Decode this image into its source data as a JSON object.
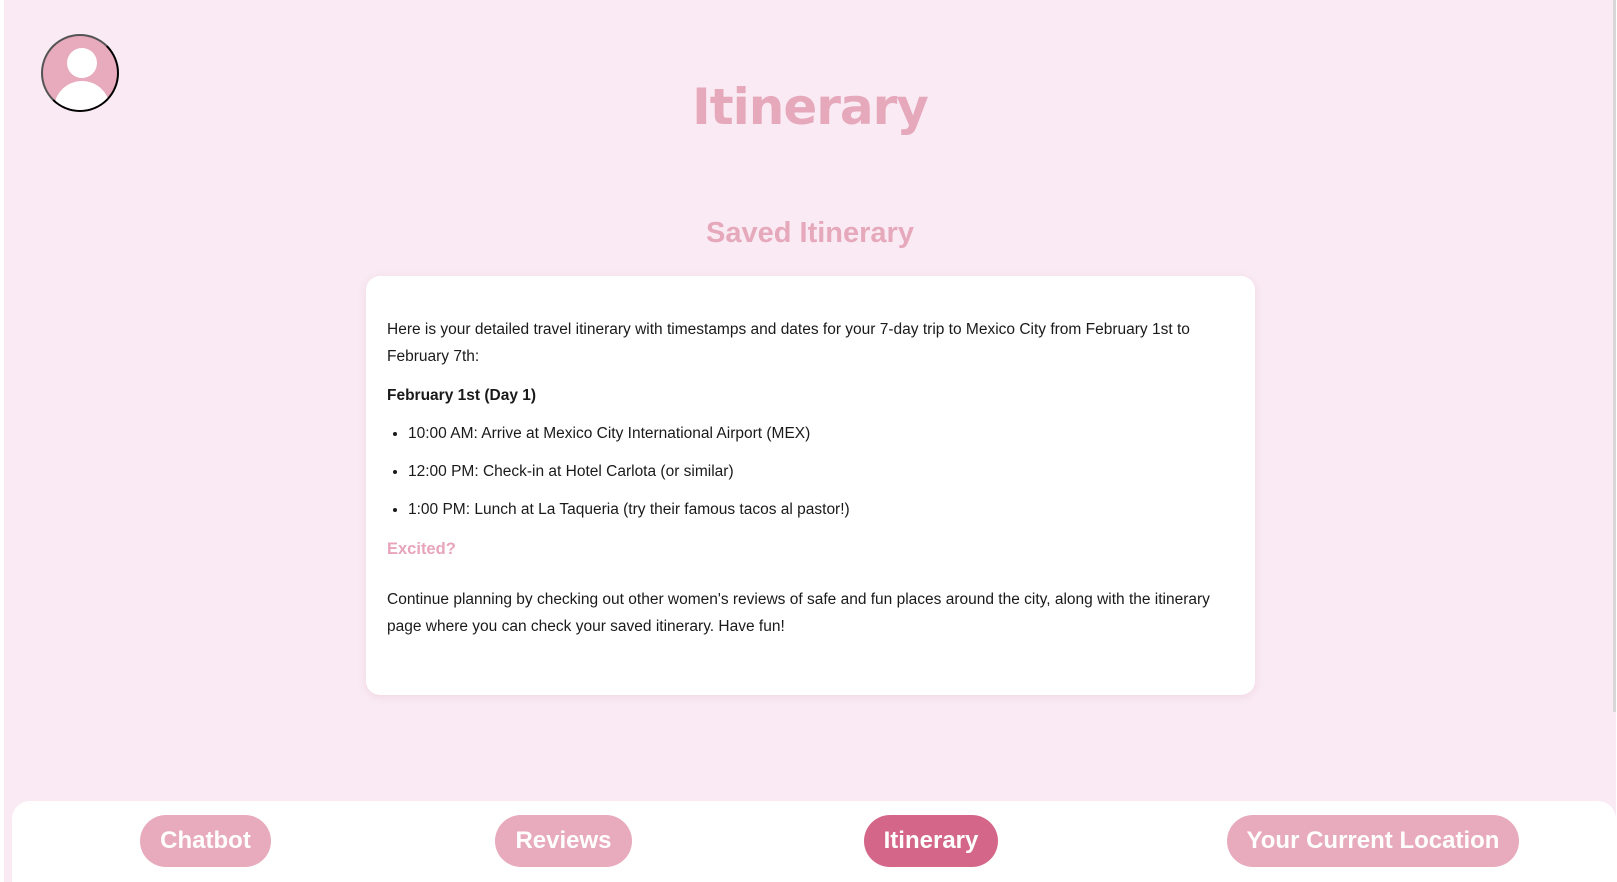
{
  "header": {
    "title": "Itinerary",
    "avatar_icon": "user-avatar-icon"
  },
  "main": {
    "section_title": "Saved Itinerary",
    "intro": "Here is your detailed travel itinerary with timestamps and dates for your 7-day trip to Mexico City from February 1st to February 7th:",
    "day_title": "February 1st (Day 1)",
    "activities": [
      "10:00 AM: Arrive at Mexico City International Airport (MEX)",
      "12:00 PM: Check-in at Hotel Carlota (or similar)",
      "1:00 PM: Lunch at La Taqueria (try their famous tacos al pastor!)"
    ],
    "excited_title": "Excited?",
    "closing": "Continue planning by checking out other women's reviews of safe and fun places around the city, along with the itinerary page where you can check your saved itinerary. Have fun!"
  },
  "bottom_nav": {
    "items": [
      {
        "label": "Chatbot",
        "active": false
      },
      {
        "label": "Reviews",
        "active": false
      },
      {
        "label": "Itinerary",
        "active": true
      },
      {
        "label": "Your Current Location",
        "active": false
      }
    ]
  },
  "colors": {
    "page_background": "#f9eaf3",
    "accent_pink": "#e8aabd",
    "active_pink": "#d46789",
    "card_background": "#ffffff"
  }
}
